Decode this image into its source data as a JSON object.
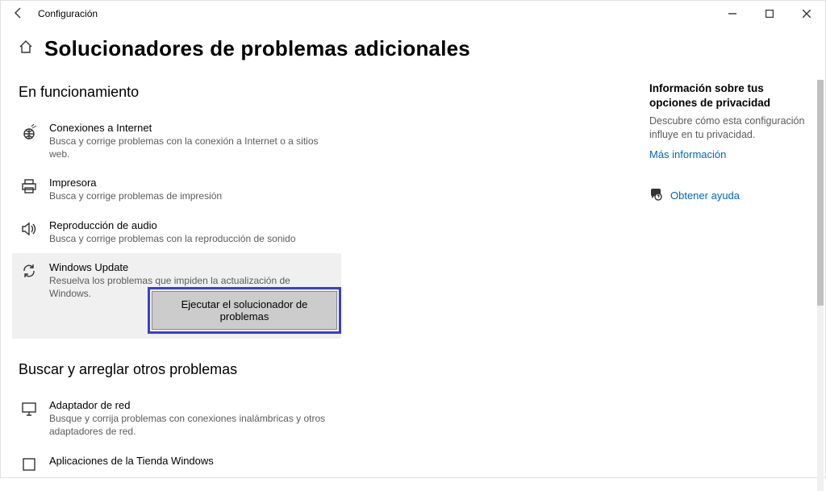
{
  "window": {
    "title": "Configuración"
  },
  "page": {
    "title": "Solucionadores de problemas adicionales"
  },
  "section1": {
    "heading": "En funcionamiento",
    "items": [
      {
        "title": "Conexiones a Internet",
        "desc": "Busca y corrige problemas con la conexión a Internet o a sitios web."
      },
      {
        "title": "Impresora",
        "desc": "Busca y corrige problemas de impresión"
      },
      {
        "title": "Reproducción de audio",
        "desc": "Busca y corrige problemas con la reproducción de sonido"
      },
      {
        "title": "Windows Update",
        "desc": "Resuelva los problemas que impiden la actualización de Windows.",
        "run_label": "Ejecutar el solucionador de problemas"
      }
    ]
  },
  "section2": {
    "heading": "Buscar y arreglar otros problemas",
    "items": [
      {
        "title": "Adaptador de red",
        "desc": "Busque y corrija problemas con conexiones inalámbricas y otros adaptadores de red."
      },
      {
        "title": "Aplicaciones de la Tienda Windows",
        "desc": ""
      }
    ]
  },
  "sidebar": {
    "heading": "Información sobre tus opciones de privacidad",
    "desc": "Descubre cómo esta configuración influye en tu privacidad.",
    "more_link": "Más información",
    "help_link": "Obtener ayuda"
  }
}
